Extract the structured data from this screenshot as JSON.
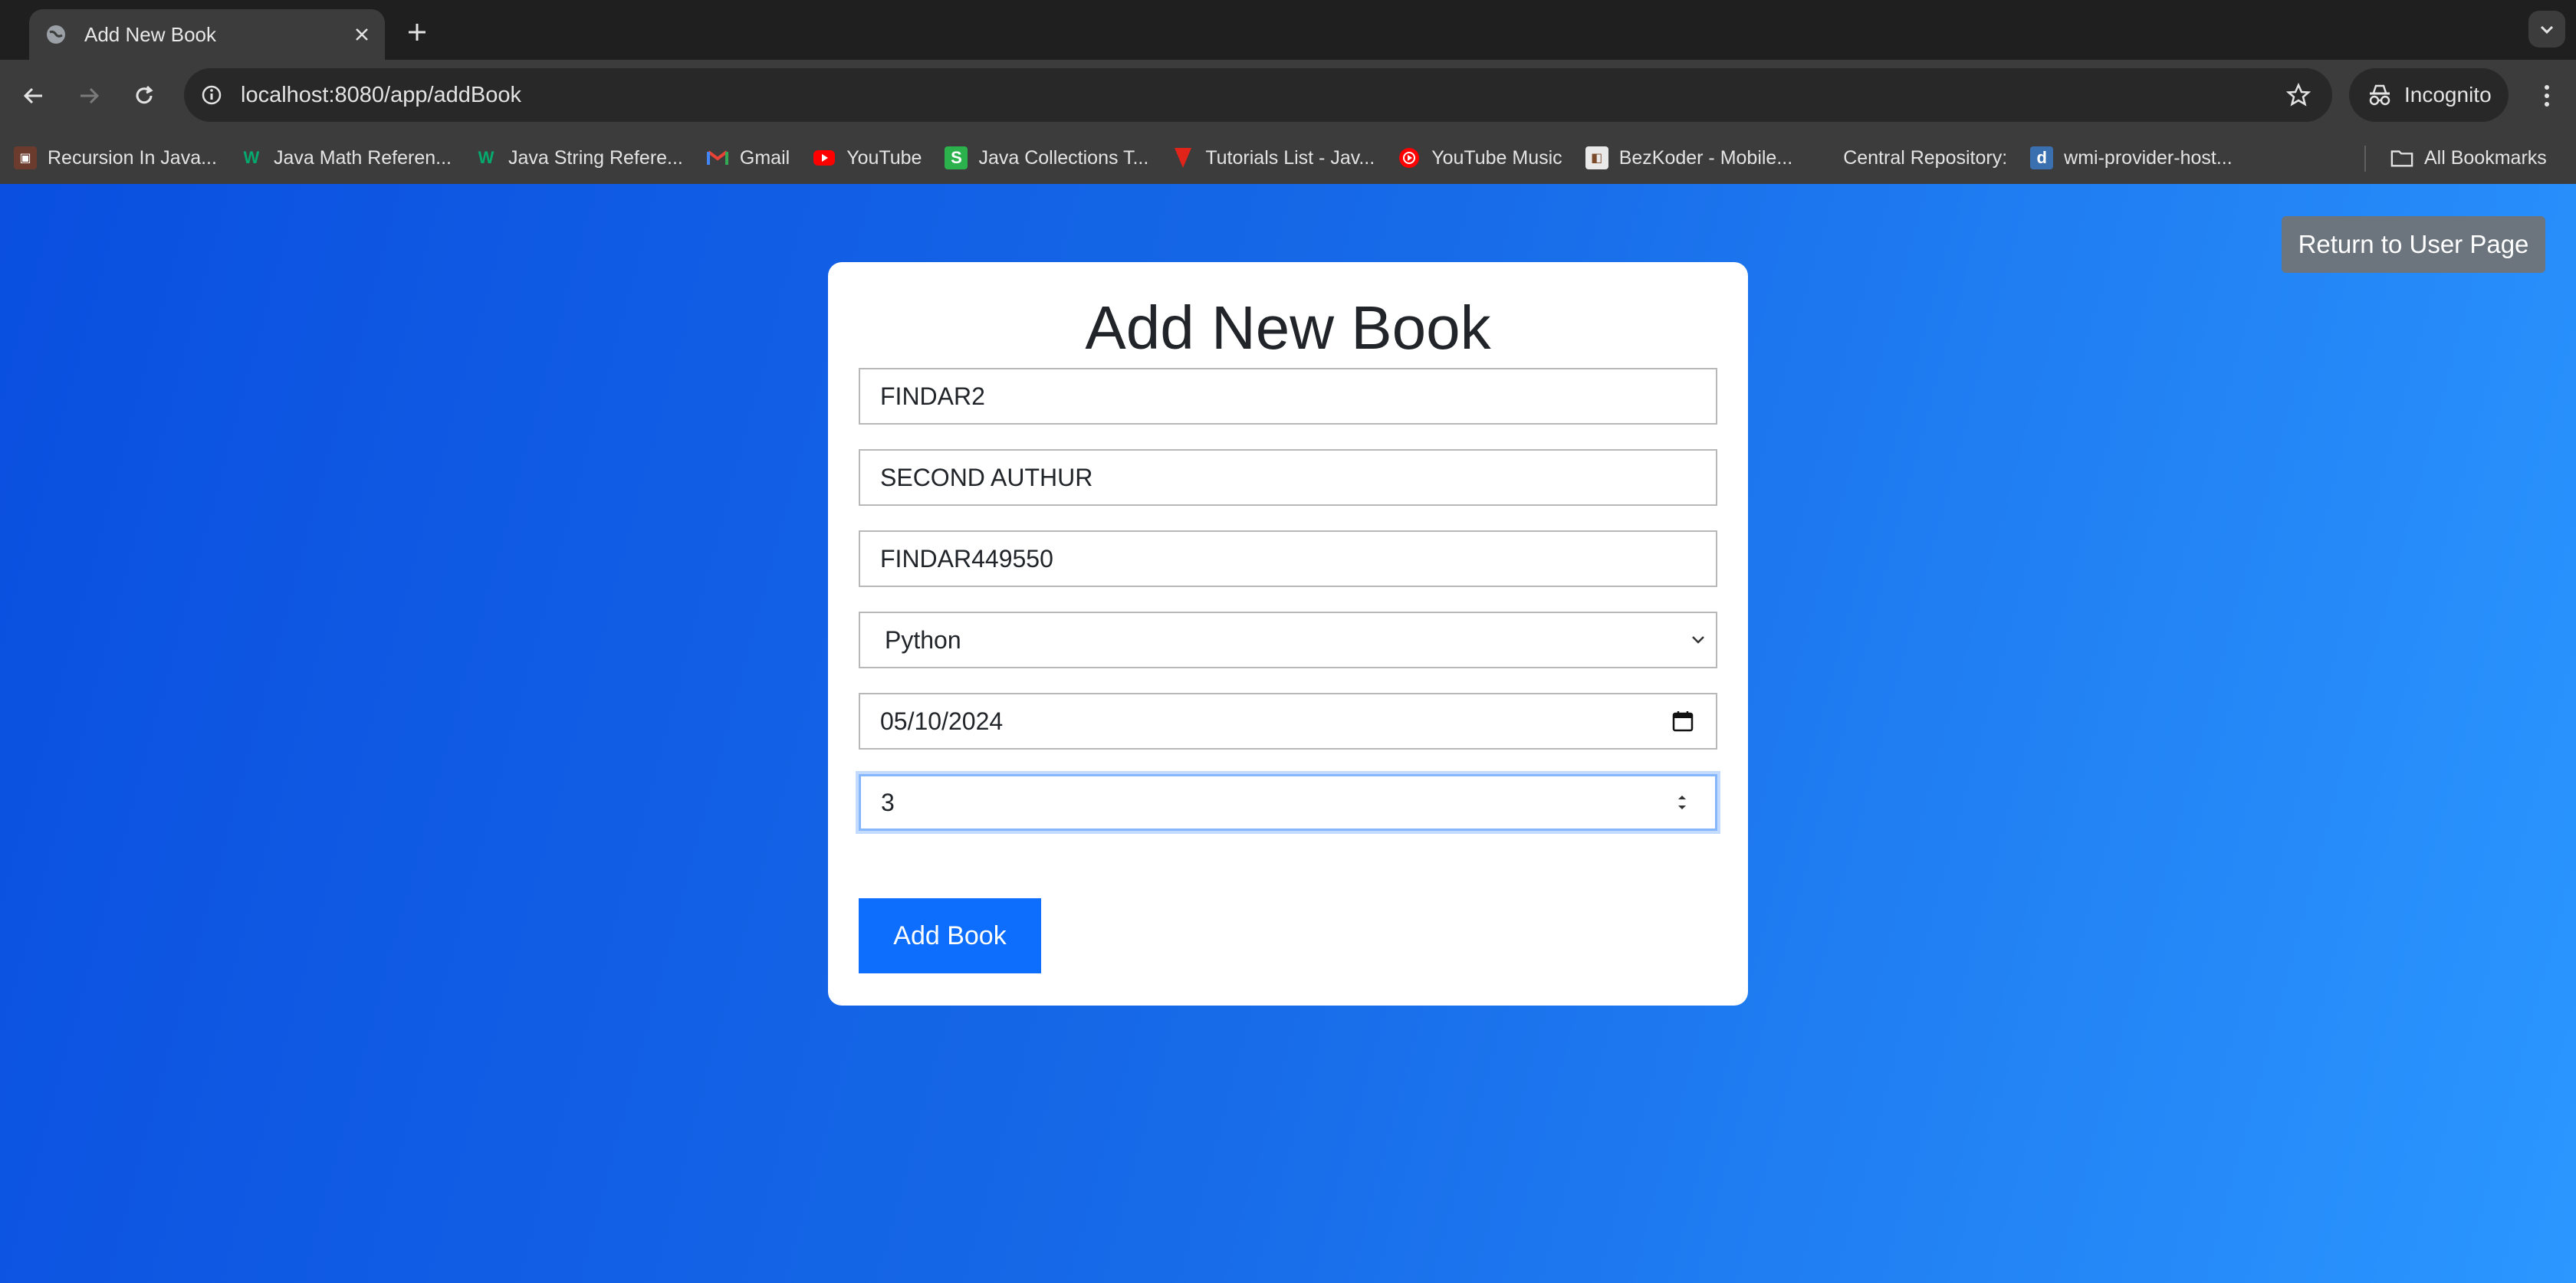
{
  "browser": {
    "tab": {
      "title": "Add New Book"
    },
    "address_bar": {
      "url": "localhost:8080/app/addBook"
    },
    "profile": {
      "label": "Incognito"
    },
    "bookmarks": [
      {
        "label": "Recursion In Java...",
        "icon": "recursion-favicon"
      },
      {
        "label": "Java Math Referen...",
        "icon": "w3-favicon"
      },
      {
        "label": "Java String Refere...",
        "icon": "w3-favicon"
      },
      {
        "label": "Gmail",
        "icon": "gmail-favicon"
      },
      {
        "label": "YouTube",
        "icon": "youtube-favicon"
      },
      {
        "label": "Java Collections T...",
        "icon": "s-favicon"
      },
      {
        "label": "Tutorials List - Jav...",
        "icon": "tutorials-favicon"
      },
      {
        "label": "YouTube Music",
        "icon": "youtube-music-favicon"
      },
      {
        "label": "BezKoder - Mobile...",
        "icon": "bezkoder-favicon"
      },
      {
        "label": "Central Repository:",
        "icon": ""
      },
      {
        "label": "wmi-provider-host...",
        "icon": "d-favicon"
      }
    ],
    "all_bookmarks": "All Bookmarks"
  },
  "page": {
    "return_button": "Return to User Page",
    "form": {
      "title": "Add New Book",
      "title_field": "FINDAR2",
      "author_field": "SECOND AUTHUR",
      "isbn_field": "FINDAR449550",
      "category_select": "Python",
      "date_field": "05/10/2024",
      "quantity_field": "3",
      "submit": "Add Book"
    }
  },
  "colors": {
    "primary": "#0d6efd",
    "secondary": "#6c757d",
    "gradient_start": "#0a4fe0",
    "gradient_end": "#2b97ff"
  }
}
